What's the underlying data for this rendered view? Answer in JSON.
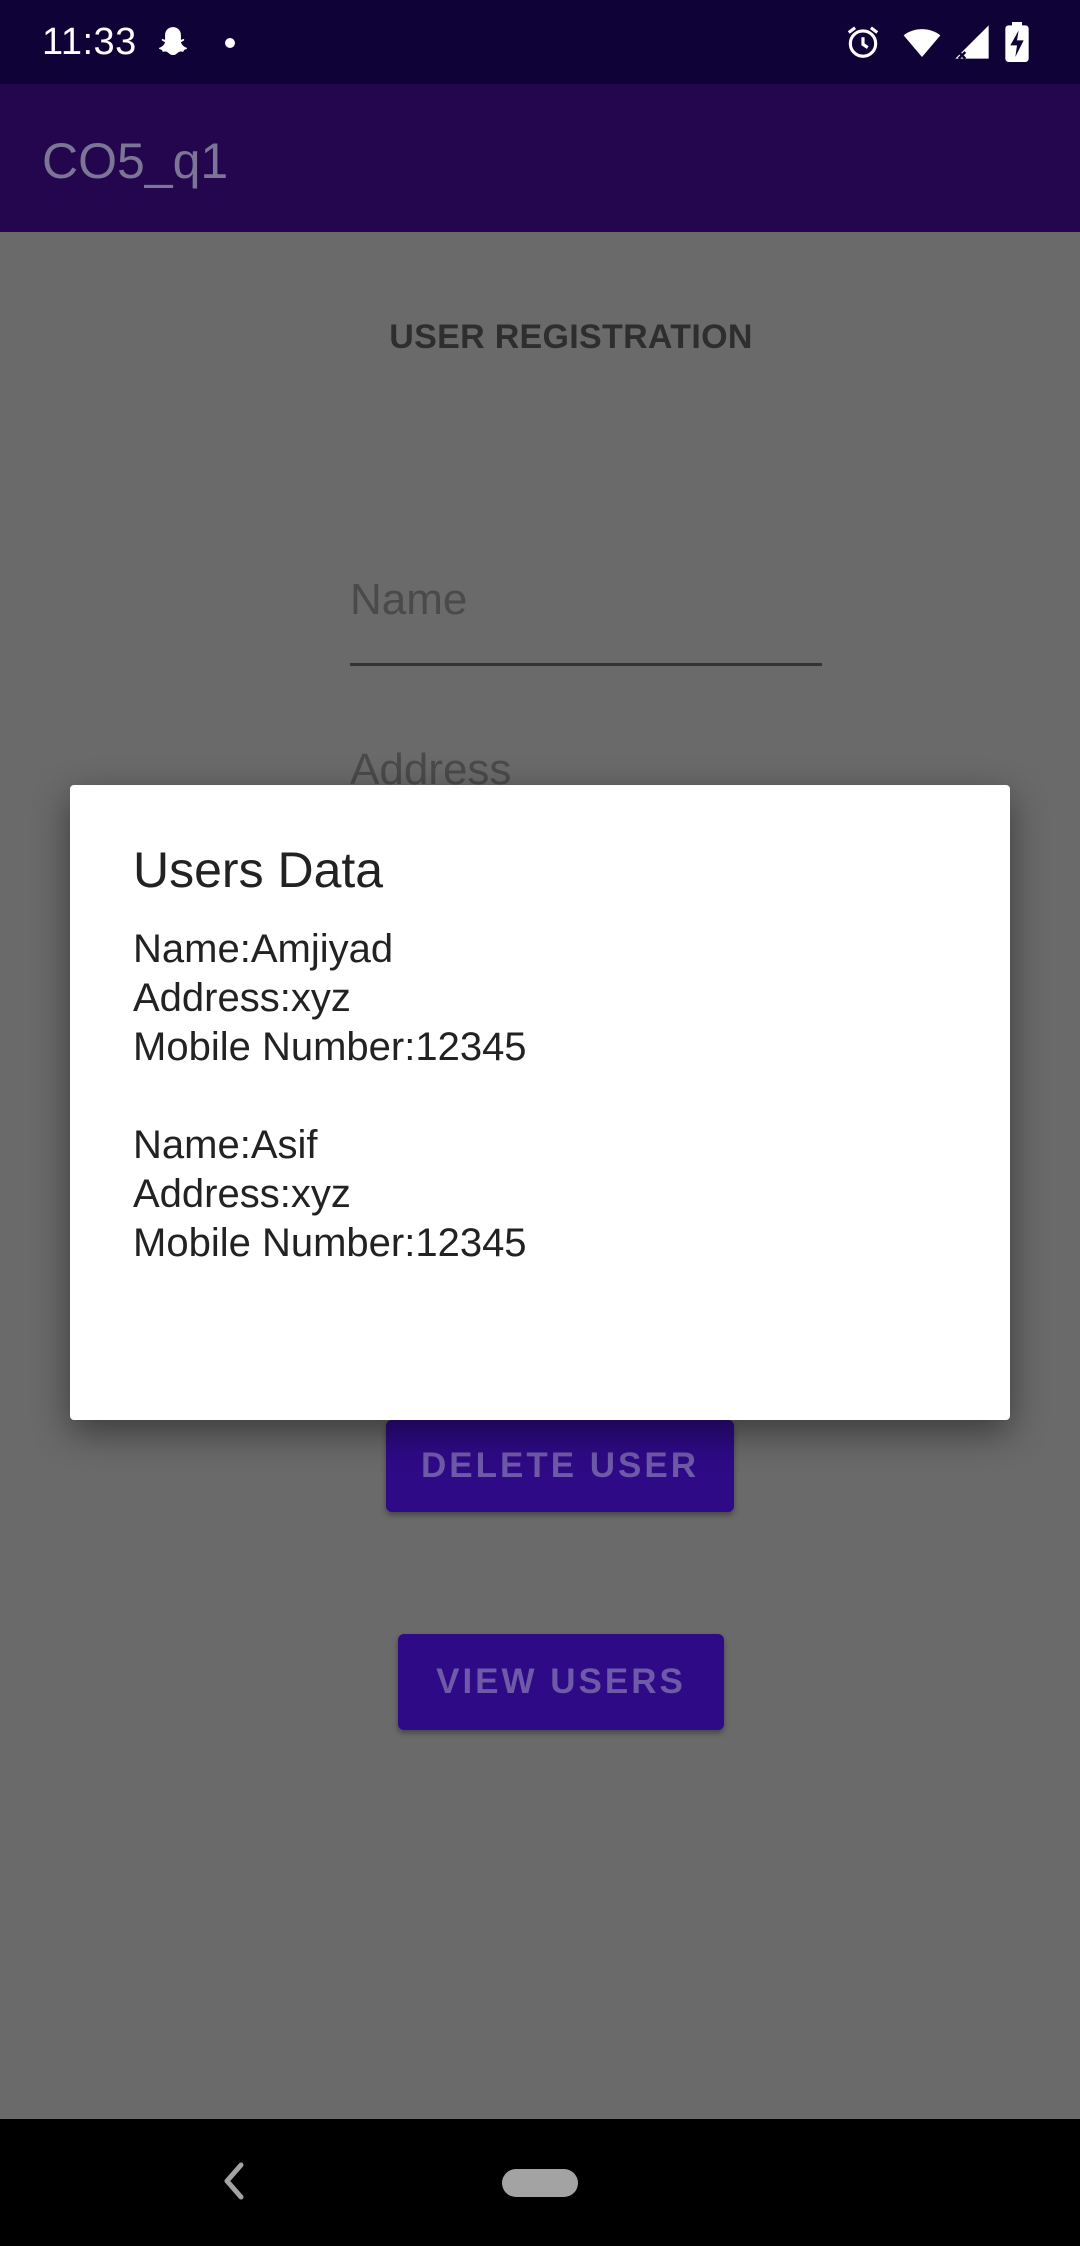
{
  "status_bar": {
    "time": "11:33",
    "icons": [
      "snapchat-icon",
      "notification-dot",
      "alarm-icon",
      "wifi-icon",
      "signal-icon",
      "battery-charging-icon"
    ]
  },
  "app_bar": {
    "title": "CO5_q1"
  },
  "form": {
    "heading": "USER REGISTRATION",
    "name_placeholder": "Name",
    "address_placeholder": "Address",
    "delete_button": "DELETE USER",
    "view_button": "VIEW USERS"
  },
  "dialog": {
    "title": "Users Data",
    "records": [
      {
        "name": "Name:Amjiyad",
        "address": "Address:xyz",
        "mobile": "Mobile Number:12345"
      },
      {
        "name": "Name:Asif",
        "address": "Address:xyz",
        "mobile": "Mobile Number:12345"
      }
    ]
  },
  "colors": {
    "status_bar": "#0e0236",
    "app_bar": "#24064f",
    "scrim_background": "#6a6a6a",
    "button": "#2e0a86"
  }
}
